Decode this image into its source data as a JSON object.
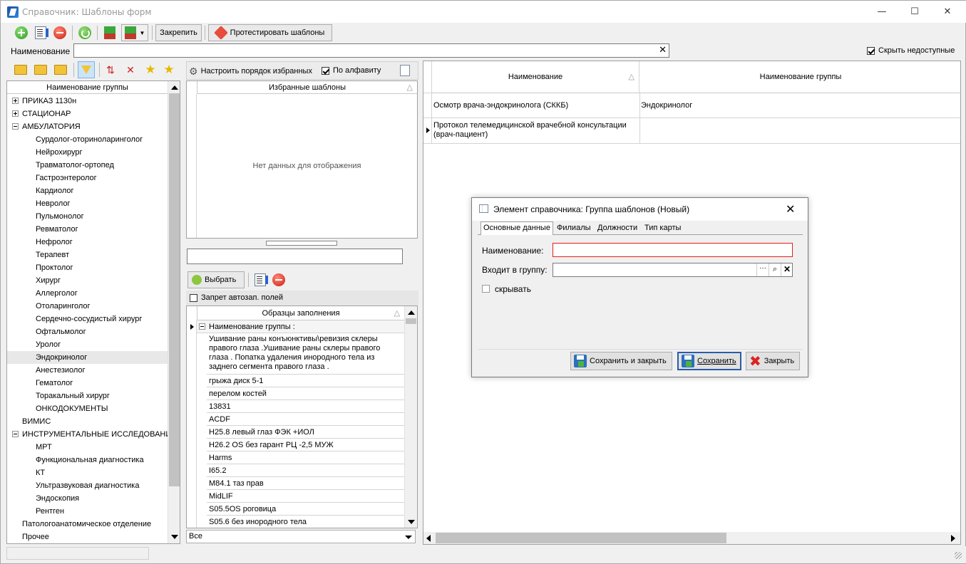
{
  "window": {
    "title": "Справочник: Шаблоны форм",
    "minimize": "—",
    "maximize": "☐",
    "close": "✕"
  },
  "toolbar": {
    "pin_label": "Закрепить",
    "test_label": "Протестировать шаблоны"
  },
  "search": {
    "label": "Наименование",
    "value": "",
    "clear": "✕",
    "hide_unavailable_label": "Скрыть недоступные",
    "hide_unavailable_checked": true
  },
  "left_panel": {
    "header": "Наименование группы",
    "tree": [
      {
        "label": "ПРИКАЗ 1130н",
        "level": 0,
        "toggle": "plus"
      },
      {
        "label": "СТАЦИОНАР",
        "level": 0,
        "toggle": "plus"
      },
      {
        "label": "АМБУЛАТОРИЯ",
        "level": 0,
        "toggle": "minus"
      },
      {
        "label": "Сурдолог-оториноларинголог",
        "level": 1
      },
      {
        "label": "Нейрохирург",
        "level": 1
      },
      {
        "label": "Травматолог-ортопед",
        "level": 1
      },
      {
        "label": "Гастроэнтеролог",
        "level": 1
      },
      {
        "label": "Кардиолог",
        "level": 1
      },
      {
        "label": "Невролог",
        "level": 1
      },
      {
        "label": "Пульмонолог",
        "level": 1
      },
      {
        "label": "Ревматолог",
        "level": 1
      },
      {
        "label": "Нефролог",
        "level": 1
      },
      {
        "label": "Терапевт",
        "level": 1
      },
      {
        "label": "Проктолог",
        "level": 1
      },
      {
        "label": "Хирург",
        "level": 1
      },
      {
        "label": "Аллерголог",
        "level": 1
      },
      {
        "label": "Отоларинголог",
        "level": 1
      },
      {
        "label": "Сердечно-сосудистый хирург",
        "level": 1
      },
      {
        "label": "Офтальмолог",
        "level": 1
      },
      {
        "label": "Уролог",
        "level": 1
      },
      {
        "label": "Эндокринолог",
        "level": 1,
        "selected": true
      },
      {
        "label": "Анестезиолог",
        "level": 1
      },
      {
        "label": "Гематолог",
        "level": 1
      },
      {
        "label": "Торакальный хирург",
        "level": 1
      },
      {
        "label": "ОНКОДОКУМЕНТЫ",
        "level": 1
      },
      {
        "label": "ВИМИС",
        "level": 0
      },
      {
        "label": "ИНСТРУМЕНТАЛЬНЫЕ ИССЛЕДОВАНИЯ",
        "level": 0,
        "toggle": "minus"
      },
      {
        "label": "МРТ",
        "level": 1
      },
      {
        "label": "Функциональная диагностика",
        "level": 1
      },
      {
        "label": "КТ",
        "level": 1
      },
      {
        "label": "Ультразвуковая диагностика",
        "level": 1
      },
      {
        "label": "Эндоскопия",
        "level": 1
      },
      {
        "label": "Рентген",
        "level": 1
      },
      {
        "label": "Патологоанатомическое отделение",
        "level": 0
      },
      {
        "label": "Прочее",
        "level": 0
      }
    ]
  },
  "middle_panel": {
    "order_button": "Настроить порядок избранных",
    "alpha_label": "По алфавиту",
    "alpha_checked": true,
    "favorites_header": "Избранные шаблоны",
    "empty_text": "Нет данных для отображения",
    "choose_button": "Выбрать",
    "no_autofill_label": "Запрет автозап. полей",
    "samples_header": "Образцы заполнения",
    "group_row_label": "Наименование группы :",
    "samples": [
      "Ушивание раны конъюнктивы\\ревизия склеры правого глаза .Ушивание раны склеры правого глаза . Попатка удаления инородного тела из заднего сегмента правого глаза .",
      "грыжа диск 5-1",
      "перелом костей",
      "13831",
      "ACDF",
      "H25.8 левый глаз ФЭК +ИОЛ",
      "H26.2 OS без гарант РЦ -2,5 МУЖ",
      "Harms",
      "I65.2",
      "M84.1 таз прав",
      "MidLIF",
      "S05.5OS роговица",
      "S05.6 без инородного тела"
    ],
    "filter_value": "Все"
  },
  "right_panel": {
    "columns": [
      "Наименование",
      "Наименование группы"
    ],
    "rows": [
      {
        "name": "Осмотр врача-эндокринолога (СККБ)",
        "group": "Эндокринолог"
      },
      {
        "name": "Протокол телемедицинской врачебной консультации (врач-пациент)",
        "group": ""
      }
    ]
  },
  "dialog": {
    "title": "Элемент справочника: Группа шаблонов (Новый)",
    "close": "✕",
    "tabs": [
      "Основные данные",
      "Филиалы",
      "Должности",
      "Тип карты"
    ],
    "name_label": "Наименование:",
    "name_value": "",
    "group_label": "Входит в группу:",
    "group_value": "",
    "group_dots": "···",
    "hide_label": "скрывать",
    "hide_checked": false,
    "save_close_button": "Сохранить и закрыть",
    "save_button": "Сохранить",
    "close_button": "Закрыть"
  },
  "colors": {
    "accent_red": "#d32f2f",
    "selection": "#e8e8e8",
    "required_border": "#e0201a"
  }
}
